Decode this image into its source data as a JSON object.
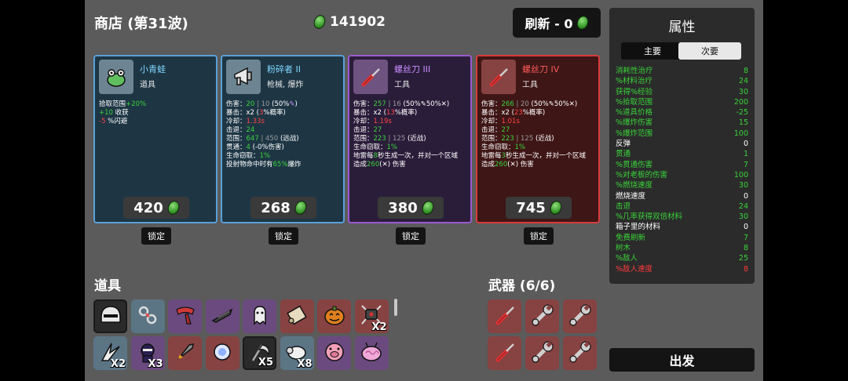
{
  "header": {
    "title": "商店 (第31波)",
    "money": "141902",
    "refresh_label": "刷新 - 0"
  },
  "cards": [
    {
      "name": "小青蛙",
      "type": "道具",
      "name_color": "#7fd6ff",
      "tier": "blue",
      "icon": "frog-icon",
      "price": "420",
      "lock": "锁定",
      "stats": [
        [
          {
            "t": "拾取范围"
          },
          {
            "t": "+20%",
            "c": "g"
          }
        ],
        [
          {
            "t": "+10",
            "c": "g"
          },
          {
            "t": " 收获"
          }
        ],
        [
          {
            "t": "-5",
            "c": "r"
          },
          {
            "t": " %闪避"
          }
        ]
      ]
    },
    {
      "name": "粉碎者 II",
      "type": "枪械, 爆炸",
      "name_color": "#7fd6ff",
      "tier": "blue",
      "icon": "megaphone-icon",
      "price": "268",
      "lock": "锁定",
      "stats": [
        [
          {
            "t": "伤害："
          },
          {
            "t": "20",
            "c": "g"
          },
          {
            "t": " | 10 ",
            "c": "dim"
          },
          {
            "t": "(50%"
          },
          {
            "t": "✎",
            "c": "pu"
          },
          {
            "t": ")"
          }
        ],
        [
          {
            "t": "暴击：x2 ("
          },
          {
            "t": "3",
            "c": "r"
          },
          {
            "t": "%概率)"
          }
        ],
        [
          {
            "t": "冷却："
          },
          {
            "t": "1.33s",
            "c": "r"
          }
        ],
        [
          {
            "t": "击退："
          },
          {
            "t": "24",
            "c": "g"
          }
        ],
        [
          {
            "t": "范围："
          },
          {
            "t": "647",
            "c": "g"
          },
          {
            "t": " | 450 ",
            "c": "dim"
          },
          {
            "t": "(远战)"
          }
        ],
        [
          {
            "t": "贯通："
          },
          {
            "t": "4",
            "c": "g"
          },
          {
            "t": " (-0%伤害)"
          }
        ],
        [
          {
            "t": "生命窃取："
          },
          {
            "t": "1%",
            "c": "g"
          }
        ],
        [
          {
            "t": "投射物命中时有"
          },
          {
            "t": "65%",
            "c": "g"
          },
          {
            "t": "爆炸"
          }
        ]
      ]
    },
    {
      "name": "螺丝刀 III",
      "type": "工具",
      "name_color": "#c98cff",
      "tier": "purple",
      "icon": "screwdriver-icon",
      "price": "380",
      "lock": "锁定",
      "stats": [
        [
          {
            "t": "伤害："
          },
          {
            "t": "257",
            "c": "g"
          },
          {
            "t": " | 16 ",
            "c": "dim"
          },
          {
            "t": "(50%✎50%✕)"
          }
        ],
        [
          {
            "t": "暴击：x2 ("
          },
          {
            "t": "13",
            "c": "r"
          },
          {
            "t": "%概率)"
          }
        ],
        [
          {
            "t": "冷却："
          },
          {
            "t": "1.19s",
            "c": "r"
          }
        ],
        [
          {
            "t": "击退："
          },
          {
            "t": "27",
            "c": "g"
          }
        ],
        [
          {
            "t": "范围："
          },
          {
            "t": "223",
            "c": "g"
          },
          {
            "t": " | 125 ",
            "c": "dim"
          },
          {
            "t": "(近战)"
          }
        ],
        [
          {
            "t": "生命窃取："
          },
          {
            "t": "1%",
            "c": "g"
          }
        ],
        [
          {
            "t": "地雷每"
          },
          {
            "t": "8",
            "c": "g"
          },
          {
            "t": "秒生成一次，并对一个区域"
          }
        ],
        [
          {
            "t": "造成"
          },
          {
            "t": "260",
            "c": "g"
          },
          {
            "t": "(✕) 伤害"
          }
        ]
      ]
    },
    {
      "name": "螺丝刀 IV",
      "type": "工具",
      "name_color": "#ff5a5a",
      "tier": "red",
      "icon": "screwdriver-icon",
      "price": "745",
      "lock": "锁定",
      "stats": [
        [
          {
            "t": "伤害："
          },
          {
            "t": "266",
            "c": "g"
          },
          {
            "t": " | 20 ",
            "c": "dim"
          },
          {
            "t": "(50%✎50%✕)"
          }
        ],
        [
          {
            "t": "暴击：x2 ("
          },
          {
            "t": "23",
            "c": "r"
          },
          {
            "t": "%概率)"
          }
        ],
        [
          {
            "t": "冷却："
          },
          {
            "t": "1.01s",
            "c": "r"
          }
        ],
        [
          {
            "t": "击退："
          },
          {
            "t": "27",
            "c": "g"
          }
        ],
        [
          {
            "t": "范围："
          },
          {
            "t": "223",
            "c": "g"
          },
          {
            "t": " | 125 ",
            "c": "dim"
          },
          {
            "t": "(近战)"
          }
        ],
        [
          {
            "t": "生命窃取："
          },
          {
            "t": "1%",
            "c": "g"
          }
        ],
        [
          {
            "t": "地雷每"
          },
          {
            "t": "3",
            "c": "g"
          },
          {
            "t": "秒生成一次，并对一个区域"
          }
        ],
        [
          {
            "t": "造成"
          },
          {
            "t": "260",
            "c": "g"
          },
          {
            "t": "(✕) 伤害"
          }
        ]
      ]
    }
  ],
  "items_title": "道具",
  "weapons_title": "武器 (6/6)",
  "items": [
    {
      "icon": "helmet-icon",
      "tier": "gray",
      "count": ""
    },
    {
      "icon": "chain-icon",
      "tier": "blue",
      "count": ""
    },
    {
      "icon": "scarf-icon",
      "tier": "purple",
      "count": ""
    },
    {
      "icon": "blade-icon",
      "tier": "purple",
      "count": ""
    },
    {
      "icon": "ghost-icon",
      "tier": "purple",
      "count": ""
    },
    {
      "icon": "scroll-icon",
      "tier": "red",
      "count": ""
    },
    {
      "icon": "pumpkin-icon",
      "tier": "red",
      "count": ""
    },
    {
      "icon": "robot-icon",
      "tier": "red",
      "count": "X2"
    },
    {
      "icon": "claw-icon",
      "tier": "blue",
      "count": "X2"
    },
    {
      "icon": "ninja-icon",
      "tier": "purple",
      "count": "X3"
    },
    {
      "icon": "rocket-icon",
      "tier": "red",
      "count": ""
    },
    {
      "icon": "orb-icon",
      "tier": "red",
      "count": ""
    },
    {
      "icon": "scythe-icon",
      "tier": "gray",
      "count": "X5"
    },
    {
      "icon": "sheep-icon",
      "tier": "blue",
      "count": "X8"
    },
    {
      "icon": "pig-icon",
      "tier": "purple",
      "count": ""
    },
    {
      "icon": "brain-icon",
      "tier": "purple",
      "count": ""
    }
  ],
  "weapons": [
    {
      "icon": "screwdriver-icon"
    },
    {
      "icon": "wrench-icon"
    },
    {
      "icon": "wrench-icon"
    },
    {
      "icon": "screwdriver-icon"
    },
    {
      "icon": "wrench-icon"
    },
    {
      "icon": "wrench-icon"
    }
  ],
  "stats_panel": {
    "title": "属性",
    "tab_main": "主要",
    "tab_secondary": "次要",
    "rows": [
      {
        "label": "消耗性治疗",
        "value": "8",
        "c": "g"
      },
      {
        "label": "%材料治疗",
        "value": "24",
        "c": "g"
      },
      {
        "label": "获得%经验",
        "value": "30",
        "c": "g"
      },
      {
        "label": "%拾取范围",
        "value": "200",
        "c": "g"
      },
      {
        "label": "%道具价格",
        "value": "-25",
        "c": "g"
      },
      {
        "label": "%爆炸伤害",
        "value": "15",
        "c": "g"
      },
      {
        "label": "%爆炸范围",
        "value": "100",
        "c": "g"
      },
      {
        "label": "反弹",
        "value": "0",
        "c": "w"
      },
      {
        "label": "贯通",
        "value": "1",
        "c": "g"
      },
      {
        "label": "%贯通伤害",
        "value": "7",
        "c": "g"
      },
      {
        "label": "%对老板的伤害",
        "value": "100",
        "c": "g"
      },
      {
        "label": "%燃烧速度",
        "value": "30",
        "c": "g"
      },
      {
        "label": "燃烧速度",
        "value": "0",
        "c": "w"
      },
      {
        "label": "击退",
        "value": "24",
        "c": "g"
      },
      {
        "label": "%几率获得双倍材料",
        "value": "30",
        "c": "g"
      },
      {
        "label": "箱子里的材料",
        "value": "0",
        "c": "w"
      },
      {
        "label": "免费刷新",
        "value": "7",
        "c": "g"
      },
      {
        "label": "树木",
        "value": "8",
        "c": "g"
      },
      {
        "label": "%敌人",
        "value": "25",
        "c": "g"
      },
      {
        "label": "%敌人速度",
        "value": "8",
        "c": "r"
      }
    ]
  },
  "go_label": "出发"
}
